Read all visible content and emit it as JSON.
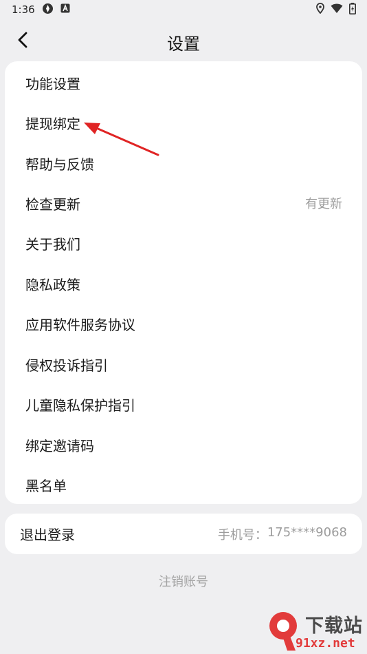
{
  "status_bar": {
    "time": "1:36"
  },
  "nav": {
    "title": "设置"
  },
  "menu": {
    "items": [
      {
        "label": "功能设置",
        "value": ""
      },
      {
        "label": "提现绑定",
        "value": ""
      },
      {
        "label": "帮助与反馈",
        "value": ""
      },
      {
        "label": "检查更新",
        "value": "有更新"
      },
      {
        "label": "关于我们",
        "value": ""
      },
      {
        "label": "隐私政策",
        "value": ""
      },
      {
        "label": "应用软件服务协议",
        "value": ""
      },
      {
        "label": "侵权投诉指引",
        "value": ""
      },
      {
        "label": "儿童隐私保护指引",
        "value": ""
      },
      {
        "label": "绑定邀请码",
        "value": ""
      },
      {
        "label": "黑名单",
        "value": ""
      }
    ]
  },
  "account": {
    "logout_label": "退出登录",
    "phone_label": "手机号：",
    "phone_value": "175****9068"
  },
  "footer": {
    "cancel_account": "注销账号"
  },
  "watermark": {
    "brand_cn": "下载站",
    "url": "91xz.net"
  },
  "colors": {
    "background": "#efeff1",
    "card": "#ffffff",
    "muted_text": "#9c9c9c",
    "annotation": "#e02424"
  }
}
